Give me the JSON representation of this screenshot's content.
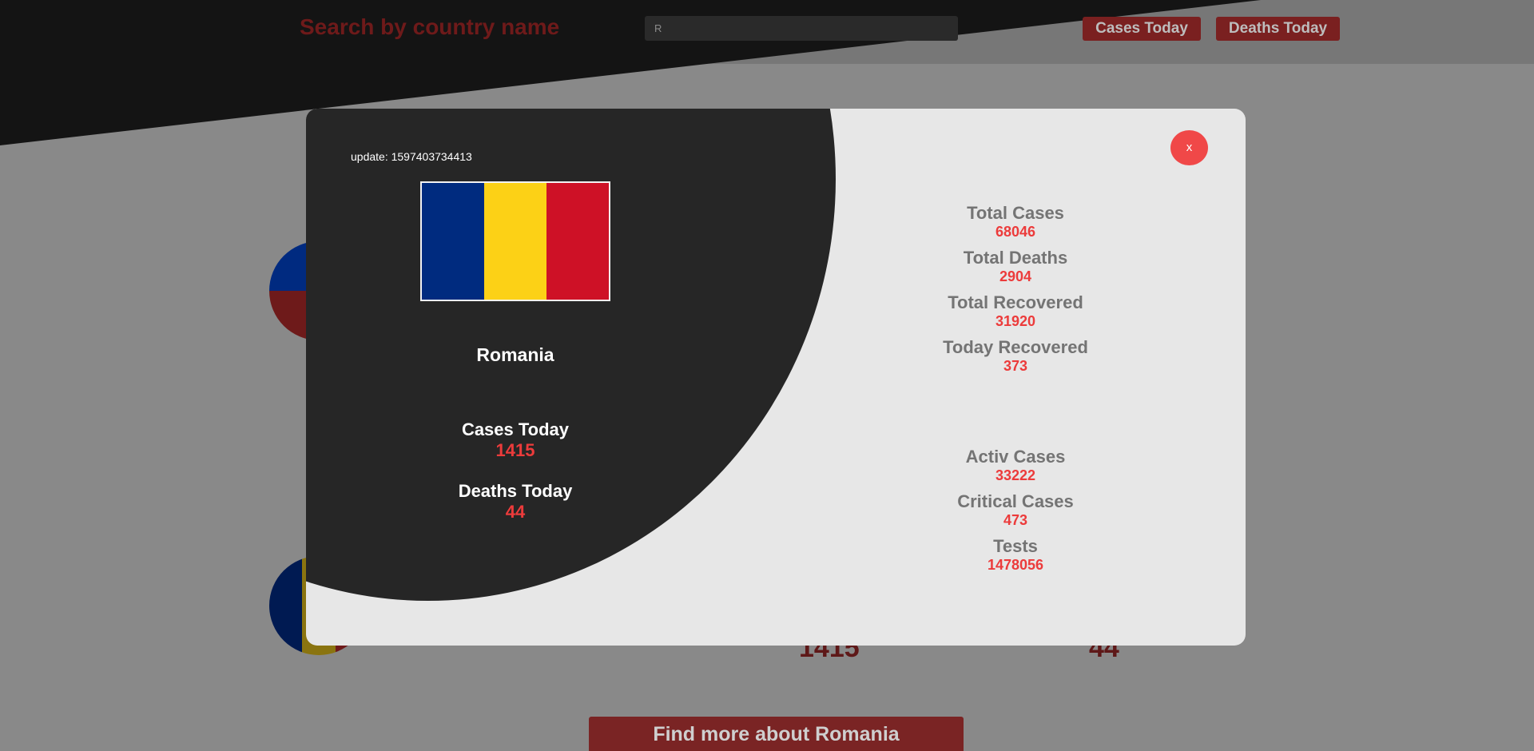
{
  "header": {
    "search_title": "Search by country name",
    "search_value": "R",
    "cases_today_label": "Cases Today",
    "deaths_today_label": "Deaths Today"
  },
  "background": {
    "row_cases_today": "1415",
    "row_deaths_today": "44",
    "find_more_label": "Find more about Romania",
    "flag_row1_colors": [
      "#002a80",
      "#6e1a1a"
    ],
    "flag_row2_colors": [
      "#001a52",
      "#8a7410",
      "#6e1a1a"
    ]
  },
  "modal": {
    "update_label": "update:",
    "update_value": "1597403734413",
    "country": "Romania",
    "flag_colors": [
      "#002b7f",
      "#fcd116",
      "#ce1126"
    ],
    "close_label": "x",
    "today": [
      {
        "label": "Cases Today",
        "value": "1415"
      },
      {
        "label": "Deaths Today",
        "value": "44"
      }
    ],
    "totals": [
      {
        "label": "Total Cases",
        "value": "68046"
      },
      {
        "label": "Total Deaths",
        "value": "2904"
      },
      {
        "label": "Total Recovered",
        "value": "31920"
      },
      {
        "label": "Today Recovered",
        "value": "373"
      }
    ],
    "active": [
      {
        "label": "Activ Cases",
        "value": "33222"
      },
      {
        "label": "Critical Cases",
        "value": "473"
      },
      {
        "label": "Tests",
        "value": "1478056"
      }
    ]
  },
  "colors": {
    "accent_red": "#ec3b3b",
    "modal_dark": "#262626",
    "modal_light": "#e7e7e7",
    "overlay_gray": "#898989"
  }
}
